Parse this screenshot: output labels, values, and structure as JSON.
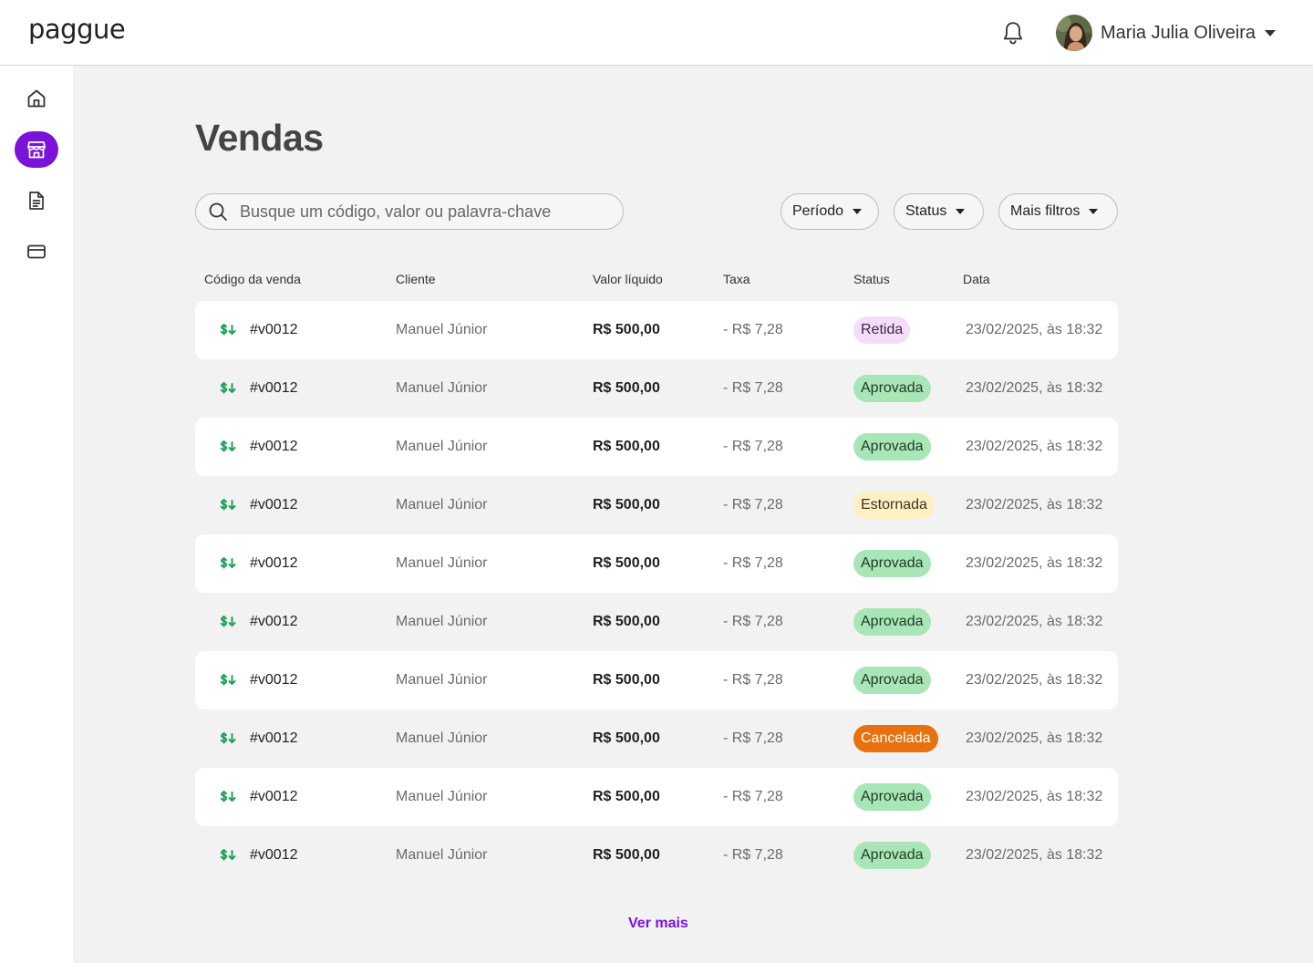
{
  "header": {
    "logo": "paggue",
    "user_name": "Maria Julia Oliveira",
    "icons": {
      "notifications": "bell-icon",
      "user_menu": "chevron-down-icon"
    }
  },
  "sidebar": {
    "items": [
      {
        "name": "home",
        "icon": "home-icon",
        "active": false
      },
      {
        "name": "vendas",
        "icon": "store-icon",
        "active": true
      },
      {
        "name": "documentos",
        "icon": "document-icon",
        "active": false
      },
      {
        "name": "cartoes",
        "icon": "credit-card-icon",
        "active": false
      }
    ],
    "active_color": "#7a12d8"
  },
  "main": {
    "title": "Vendas",
    "search": {
      "placeholder": "Busque um código, valor ou palavra-chave",
      "value": ""
    },
    "filters": [
      "Período",
      "Status",
      "Mais filtros"
    ],
    "table": {
      "columns": [
        "Código da venda",
        "Cliente",
        "Valor líquido",
        "Taxa",
        "Status",
        "Data"
      ],
      "rows": [
        {
          "code": "#v0012",
          "client": "Manuel Júnior",
          "valor": "R$ 500,00",
          "taxa": "- R$ 7,28",
          "status": "Retida",
          "date": "23/02/2025, às 18:32"
        },
        {
          "code": "#v0012",
          "client": "Manuel Júnior",
          "valor": "R$ 500,00",
          "taxa": "- R$ 7,28",
          "status": "Aprovada",
          "date": "23/02/2025, às 18:32"
        },
        {
          "code": "#v0012",
          "client": "Manuel Júnior",
          "valor": "R$ 500,00",
          "taxa": "- R$ 7,28",
          "status": "Aprovada",
          "date": "23/02/2025, às 18:32"
        },
        {
          "code": "#v0012",
          "client": "Manuel Júnior",
          "valor": "R$ 500,00",
          "taxa": "- R$ 7,28",
          "status": "Estornada",
          "date": "23/02/2025, às 18:32"
        },
        {
          "code": "#v0012",
          "client": "Manuel Júnior",
          "valor": "R$ 500,00",
          "taxa": "- R$ 7,28",
          "status": "Aprovada",
          "date": "23/02/2025, às 18:32"
        },
        {
          "code": "#v0012",
          "client": "Manuel Júnior",
          "valor": "R$ 500,00",
          "taxa": "- R$ 7,28",
          "status": "Aprovada",
          "date": "23/02/2025, às 18:32"
        },
        {
          "code": "#v0012",
          "client": "Manuel Júnior",
          "valor": "R$ 500,00",
          "taxa": "- R$ 7,28",
          "status": "Aprovada",
          "date": "23/02/2025, às 18:32"
        },
        {
          "code": "#v0012",
          "client": "Manuel Júnior",
          "valor": "R$ 500,00",
          "taxa": "- R$ 7,28",
          "status": "Cancelada",
          "date": "23/02/2025, às 18:32"
        },
        {
          "code": "#v0012",
          "client": "Manuel Júnior",
          "valor": "R$ 500,00",
          "taxa": "- R$ 7,28",
          "status": "Aprovada",
          "date": "23/02/2025, às 18:32"
        },
        {
          "code": "#v0012",
          "client": "Manuel Júnior",
          "valor": "R$ 500,00",
          "taxa": "- R$ 7,28",
          "status": "Aprovada",
          "date": "23/02/2025, às 18:32"
        }
      ],
      "row_icon": "money-incoming-icon",
      "status_colors": {
        "Retida": {
          "bg": "#f5dcfa",
          "fg": "#3a2a3c"
        },
        "Aprovada": {
          "bg": "#a8e6b8",
          "fg": "#1e3a24"
        },
        "Estornada": {
          "bg": "#fdf0c4",
          "fg": "#3a3420"
        },
        "Cancelada": {
          "bg": "#e8700f",
          "fg": "#ffffff"
        }
      }
    },
    "load_more": "Ver mais"
  }
}
